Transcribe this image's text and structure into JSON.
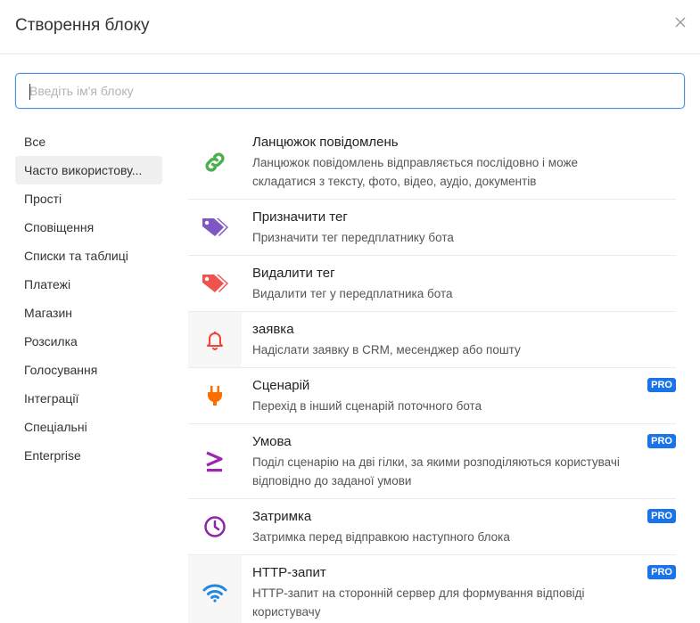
{
  "modal": {
    "title": "Створення блоку"
  },
  "search": {
    "placeholder": "Введіть ім'я блоку",
    "value": ""
  },
  "sidebar": {
    "items": [
      {
        "label": "Все",
        "active": false
      },
      {
        "label": "Часто використову...",
        "active": true
      },
      {
        "label": "Прості",
        "active": false
      },
      {
        "label": "Сповіщення",
        "active": false
      },
      {
        "label": "Списки та таблиці",
        "active": false
      },
      {
        "label": "Платежі",
        "active": false
      },
      {
        "label": "Магазин",
        "active": false
      },
      {
        "label": "Розсилка",
        "active": false
      },
      {
        "label": "Голосування",
        "active": false
      },
      {
        "label": "Інтеграції",
        "active": false
      },
      {
        "label": "Спеціальні",
        "active": false
      },
      {
        "label": "Enterprise",
        "active": false
      }
    ]
  },
  "blocks": [
    {
      "title": "Ланцюжок повідомлень",
      "desc": "Ланцюжок повідомлень відправляється послідовно і може складатися з тексту, фото, відео, аудіо, документів",
      "icon": "link-icon",
      "color": "#4caf50",
      "pro": false
    },
    {
      "title": "Призначити тег",
      "desc": "Призначити тег передплатнику бота",
      "icon": "tags-icon",
      "color": "#7e57c2",
      "pro": false
    },
    {
      "title": "Видалити тег",
      "desc": "Видалити тег у передплатника бота",
      "icon": "tags-icon",
      "color": "#ef5350",
      "pro": false
    },
    {
      "title": "заявка",
      "desc": "Надіслати заявку в CRM, месенджер або пошту",
      "icon": "bell-icon",
      "color": "#f44336",
      "pro": false
    },
    {
      "title": "Сценарій",
      "desc": "Перехід в інший сценарій поточного бота",
      "icon": "plug-icon",
      "color": "#ff6d00",
      "pro": true
    },
    {
      "title": "Умова",
      "desc": "Поділ сценарію на дві гілки, за якими розподіляються користувачі відповідно до заданої умови",
      "icon": "greater-equal-icon",
      "color": "#9c27b0",
      "pro": true
    },
    {
      "title": "Затримка",
      "desc": "Затримка перед відправкою наступного блока",
      "icon": "clock-icon",
      "color": "#8e24aa",
      "pro": true
    },
    {
      "title": "HTTP-запит",
      "desc": "HTTP-запит на сторонній сервер для формування відповіді користувачу",
      "icon": "wifi-icon",
      "color": "#1e88e5",
      "pro": true
    }
  ],
  "pro_label": "PRO",
  "colors": {
    "accent": "#4a90e2",
    "pro_badge": "#1a73e8"
  }
}
